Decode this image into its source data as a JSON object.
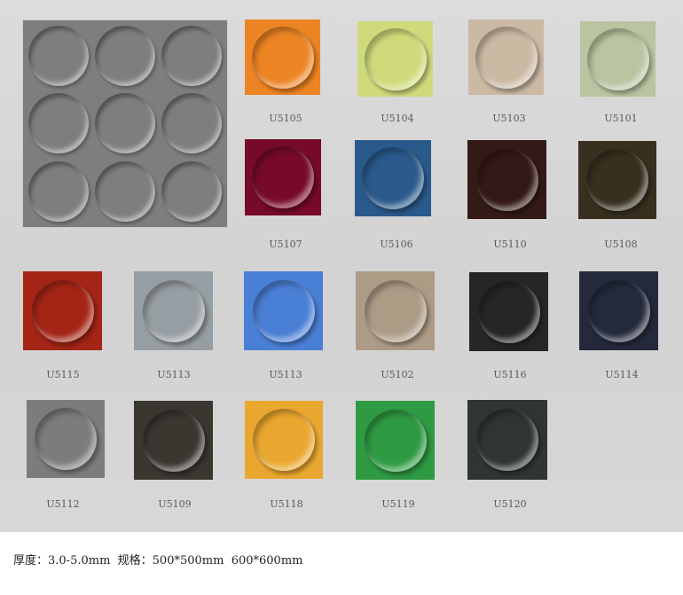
{
  "swatches": [
    {
      "code": "U5105",
      "color": "#ed8423"
    },
    {
      "code": "U5104",
      "color": "#cfdb7b"
    },
    {
      "code": "U5103",
      "color": "#ccb9a4"
    },
    {
      "code": "U5101",
      "color": "#b9c4a0"
    },
    {
      "code": "U5107",
      "color": "#780a29"
    },
    {
      "code": "U5106",
      "color": "#2a5a8c"
    },
    {
      "code": "U5110",
      "color": "#331a17"
    },
    {
      "code": "U5108",
      "color": "#37301f"
    },
    {
      "code": "U5115",
      "color": "#a42516"
    },
    {
      "code": "U5113",
      "color": "#969ea3"
    },
    {
      "code": "U5113",
      "color": "#4a7fd6"
    },
    {
      "code": "U5102",
      "color": "#ad9b86"
    },
    {
      "code": "U5116",
      "color": "#262626"
    },
    {
      "code": "U5114",
      "color": "#242a3c"
    },
    {
      "code": "U5112",
      "color": "#7a7d7b"
    },
    {
      "code": "U5109",
      "color": "#3a3630"
    },
    {
      "code": "U5118",
      "color": "#eaa72f"
    },
    {
      "code": "U5119",
      "color": "#2e9a42"
    },
    {
      "code": "U5120",
      "color": "#303532"
    }
  ],
  "large_sample_color": "#7e7e7e",
  "footer": {
    "text": "厚度：3.0-5.0mm  规格：500*500mm  600*600mm"
  }
}
